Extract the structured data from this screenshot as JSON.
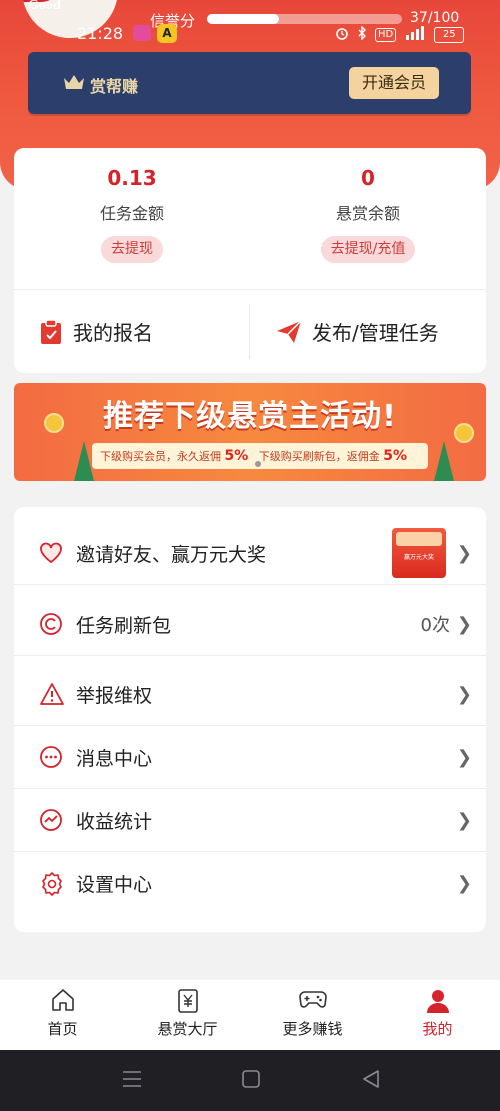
{
  "avatar": {
    "text": "Good"
  },
  "status_bar": {
    "time": "21:28",
    "credit_label": "信誉分",
    "credit_value": 37,
    "credit_max": 100,
    "credit_text": "37/100",
    "hd": "HD",
    "battery": "25"
  },
  "vip": {
    "title": "赏帮赚",
    "button": "开通会员"
  },
  "stats": {
    "task_amount": {
      "value": "0.13",
      "label": "任务金额",
      "button": "去提现"
    },
    "reward_balance": {
      "value": "0",
      "label": "悬赏余额",
      "button": "去提现/充值"
    }
  },
  "actions": {
    "my_signup": "我的报名",
    "publish_manage": "发布/管理任务"
  },
  "promo": {
    "title": "推荐下级悬赏主活动!",
    "strip_a": "下级购买会员，永久返佣",
    "strip_a_pct": "5%",
    "strip_b": "下级购买刷新包，返佣金",
    "strip_b_pct": "5%",
    "redpack_text": "赢万元大奖"
  },
  "menu": [
    {
      "label": "邀请好友、赢万元大奖",
      "value": "",
      "icon": "heart-icon"
    },
    {
      "label": "任务刷新包",
      "value": "0次",
      "icon": "refresh-icon"
    },
    {
      "label": "举报维权",
      "value": "",
      "icon": "warning-icon"
    },
    {
      "label": "消息中心",
      "value": "",
      "icon": "message-icon"
    },
    {
      "label": "收益统计",
      "value": "",
      "icon": "trend-icon"
    },
    {
      "label": "设置中心",
      "value": "",
      "icon": "gear-icon"
    }
  ],
  "tabs": [
    {
      "label": "首页",
      "icon": "home-icon"
    },
    {
      "label": "悬赏大厅",
      "icon": "yen-icon"
    },
    {
      "label": "更多赚钱",
      "icon": "gamepad-icon"
    },
    {
      "label": "我的",
      "icon": "user-icon"
    }
  ],
  "colors": {
    "primary": "#d6222a",
    "hero": "#e7473a",
    "vip_bg": "#2c3e6b",
    "vip_btn": "#f5d39e"
  }
}
